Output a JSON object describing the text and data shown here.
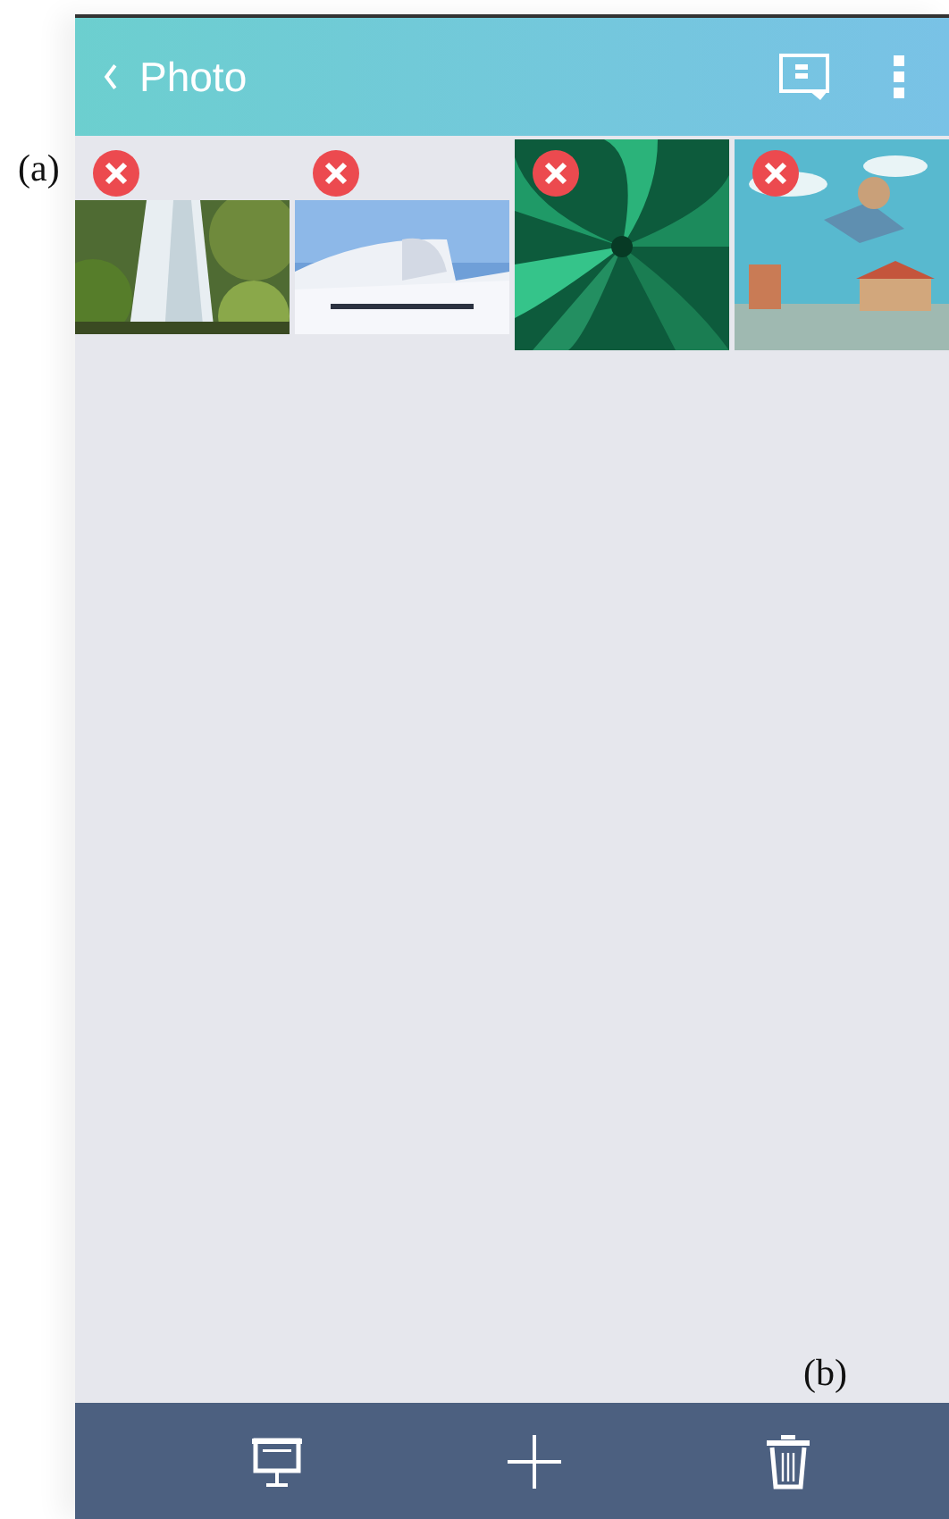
{
  "header": {
    "title": "Photo"
  },
  "photos": [
    {
      "kind": "landscape"
    },
    {
      "kind": "landscape"
    },
    {
      "kind": "square"
    },
    {
      "kind": "square"
    }
  ],
  "annotations": [
    {
      "label": "(a)",
      "kind": "margin"
    },
    {
      "label": "(b)",
      "kind": "corner"
    }
  ]
}
